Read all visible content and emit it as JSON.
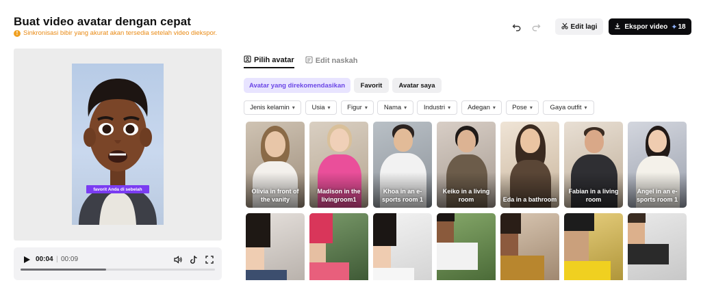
{
  "header": {
    "title": "Buat video avatar dengan cepat",
    "notice": "Sinkronisasi bibir yang akurat akan tersedia setelah video diekspor.",
    "notice_icon": "!",
    "edit_label": "Edit lagi",
    "export_label": "Ekspor video",
    "export_credit": "18"
  },
  "preview": {
    "caption": "favorit Anda di sebelah"
  },
  "player": {
    "current_time": "00:04",
    "separator": "|",
    "total_time": "00:09",
    "progress": 0.44
  },
  "tabs": [
    {
      "label": "Pilih avatar",
      "active": true
    },
    {
      "label": "Edit naskah",
      "active": false
    }
  ],
  "categories": [
    {
      "label": "Avatar yang direkomendasikan",
      "selected": true
    },
    {
      "label": "Favorit",
      "selected": false
    },
    {
      "label": "Avatar saya",
      "selected": false
    }
  ],
  "filters": [
    "Jenis kelamin",
    "Usia",
    "Figur",
    "Nama",
    "Industri",
    "Adegan",
    "Pose",
    "Gaya outfit"
  ],
  "avatars_row1": [
    {
      "name": "Olivia in front of the vanity"
    },
    {
      "name": "Madison in the livingroom1"
    },
    {
      "name": "Khoa in an e-sports room 1"
    },
    {
      "name": "Keiko in a living room"
    },
    {
      "name": "Eda in a bathroom"
    },
    {
      "name": "Fabian in a living room"
    },
    {
      "name": "Angel in an e-sports room 1"
    }
  ],
  "colors": {
    "accent": "#7a3cf2",
    "selected_pill_bg": "#e8e4ff",
    "selected_pill_text": "#6a45e6",
    "notice": "#e98a14",
    "export_bg": "#0b0b0e"
  }
}
